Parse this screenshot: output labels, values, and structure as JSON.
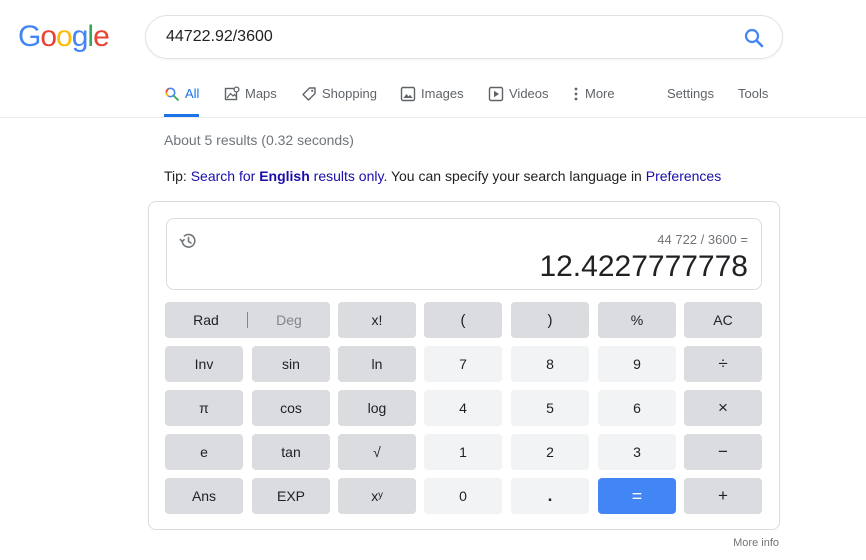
{
  "logo": {
    "letters": [
      "G",
      "o",
      "o",
      "g",
      "l",
      "e"
    ],
    "colors": [
      "#4285f4",
      "#ea4335",
      "#fbbc05",
      "#4285f4",
      "#34a853",
      "#ea4335"
    ]
  },
  "search": {
    "value": "44722.92/3600",
    "icon": "search-icon"
  },
  "tabs": [
    {
      "label": "All",
      "icon": "search-icon",
      "active": true
    },
    {
      "label": "Maps",
      "icon": "maps-icon"
    },
    {
      "label": "Shopping",
      "icon": "tag-icon"
    },
    {
      "label": "Images",
      "icon": "image-icon"
    },
    {
      "label": "Videos",
      "icon": "play-icon"
    },
    {
      "label": "More",
      "icon": "more-vert-icon"
    },
    {
      "label": "Settings"
    },
    {
      "label": "Tools"
    }
  ],
  "stats": "About 5 results (0.32 seconds)",
  "tip": {
    "prefix": "Tip: ",
    "link1": "Search for ",
    "bold": "English",
    "link2": " results only",
    "mid": ". You can specify your search language in ",
    "pref_link": "Preferences"
  },
  "calculator": {
    "expression": "44 722 / 3600 =",
    "result": "12.4227777778",
    "rad_label": "Rad",
    "deg_label": "Deg",
    "keys": {
      "fact": "x!",
      "lparen": "(",
      "rparen": ")",
      "percent": "%",
      "ac": "AC",
      "inv": "Inv",
      "sin": "sin",
      "ln": "ln",
      "k7": "7",
      "k8": "8",
      "k9": "9",
      "div": "÷",
      "pi": "π",
      "cos": "cos",
      "log": "log",
      "k4": "4",
      "k5": "5",
      "k6": "6",
      "mul": "×",
      "e": "e",
      "tan": "tan",
      "sqrt": "√",
      "k1": "1",
      "k2": "2",
      "k3": "3",
      "minus": "−",
      "ans": "Ans",
      "exp": "EXP",
      "pow": "xʸ",
      "k0": "0",
      "dot": ".",
      "eq": "=",
      "plus": "+"
    }
  },
  "more_info": "More info"
}
